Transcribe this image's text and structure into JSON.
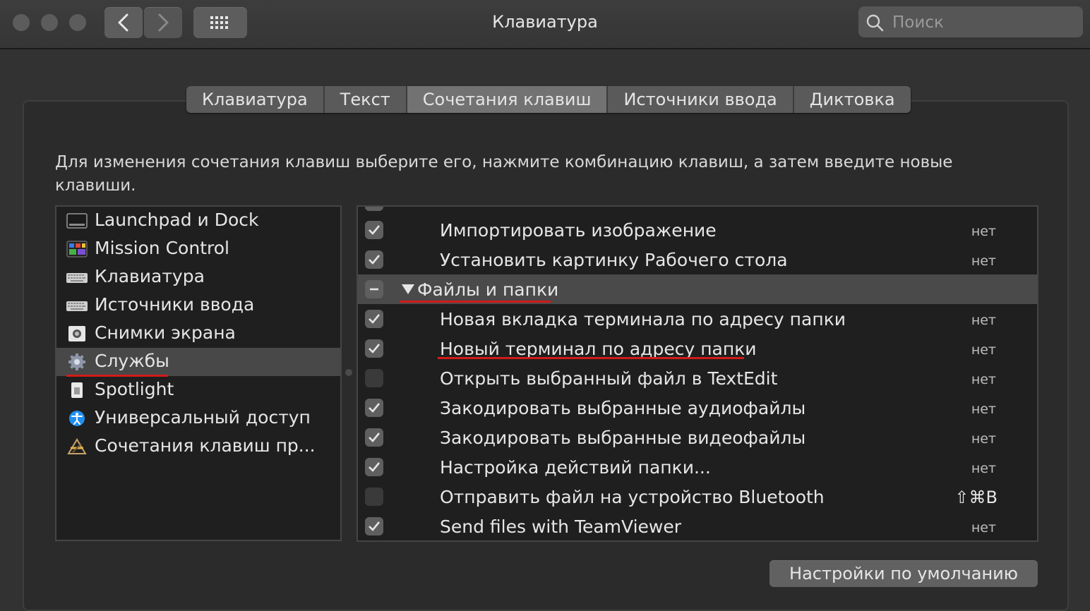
{
  "window": {
    "title": "Клавиатура",
    "search_placeholder": "Поиск"
  },
  "tabs": [
    {
      "label": "Клавиатура",
      "active": false
    },
    {
      "label": "Текст",
      "active": false
    },
    {
      "label": "Сочетания клавиш",
      "active": true
    },
    {
      "label": "Источники ввода",
      "active": false
    },
    {
      "label": "Диктовка",
      "active": false
    }
  ],
  "description": "Для изменения сочетания клавиш выберите его, нажмите комбинацию клавиш, а затем введите новые клавиши.",
  "categories": [
    {
      "label": "Launchpad и Dock",
      "icon": "launchpad-dock-icon"
    },
    {
      "label": "Mission Control",
      "icon": "mission-control-icon"
    },
    {
      "label": "Клавиатура",
      "icon": "keyboard-icon"
    },
    {
      "label": "Источники ввода",
      "icon": "keyboard-icon"
    },
    {
      "label": "Снимки экрана",
      "icon": "screenshot-icon"
    },
    {
      "label": "Службы",
      "icon": "gear-icon",
      "selected": true
    },
    {
      "label": "Spotlight",
      "icon": "spotlight-icon"
    },
    {
      "label": "Универсальный доступ",
      "icon": "accessibility-icon"
    },
    {
      "label": "Сочетания клавиш пр...",
      "icon": "app-shortcuts-icon"
    }
  ],
  "services": [
    {
      "label": "Импортировать изображение",
      "checked": true,
      "shortcut": "нет"
    },
    {
      "label": "Установить картинку Рабочего стола",
      "checked": true,
      "shortcut": "нет"
    },
    {
      "label": "Файлы и папки",
      "group": true,
      "expanded": true
    },
    {
      "label": "Новая вкладка терминала по адресу папки",
      "checked": true,
      "shortcut": "нет"
    },
    {
      "label": "Новый терминал по адресу папки",
      "checked": true,
      "shortcut": "нет"
    },
    {
      "label": "Открыть выбранный файл в TextEdit",
      "checked": false,
      "shortcut": "нет"
    },
    {
      "label": "Закодировать выбранные аудиофайлы",
      "checked": true,
      "shortcut": "нет"
    },
    {
      "label": "Закодировать выбранные видеофайлы",
      "checked": true,
      "shortcut": "нет"
    },
    {
      "label": "Настройка действий папки...",
      "checked": true,
      "shortcut": "нет"
    },
    {
      "label": "Отправить файл на устройство Bluetooth",
      "checked": false,
      "shortcut": "⇧⌘B"
    },
    {
      "label": "Send files with TeamViewer",
      "checked": true,
      "shortcut": "нет"
    }
  ],
  "defaults_button": "Настройки по умолчанию",
  "colors": {
    "annotation_red": "#d21a1a"
  }
}
